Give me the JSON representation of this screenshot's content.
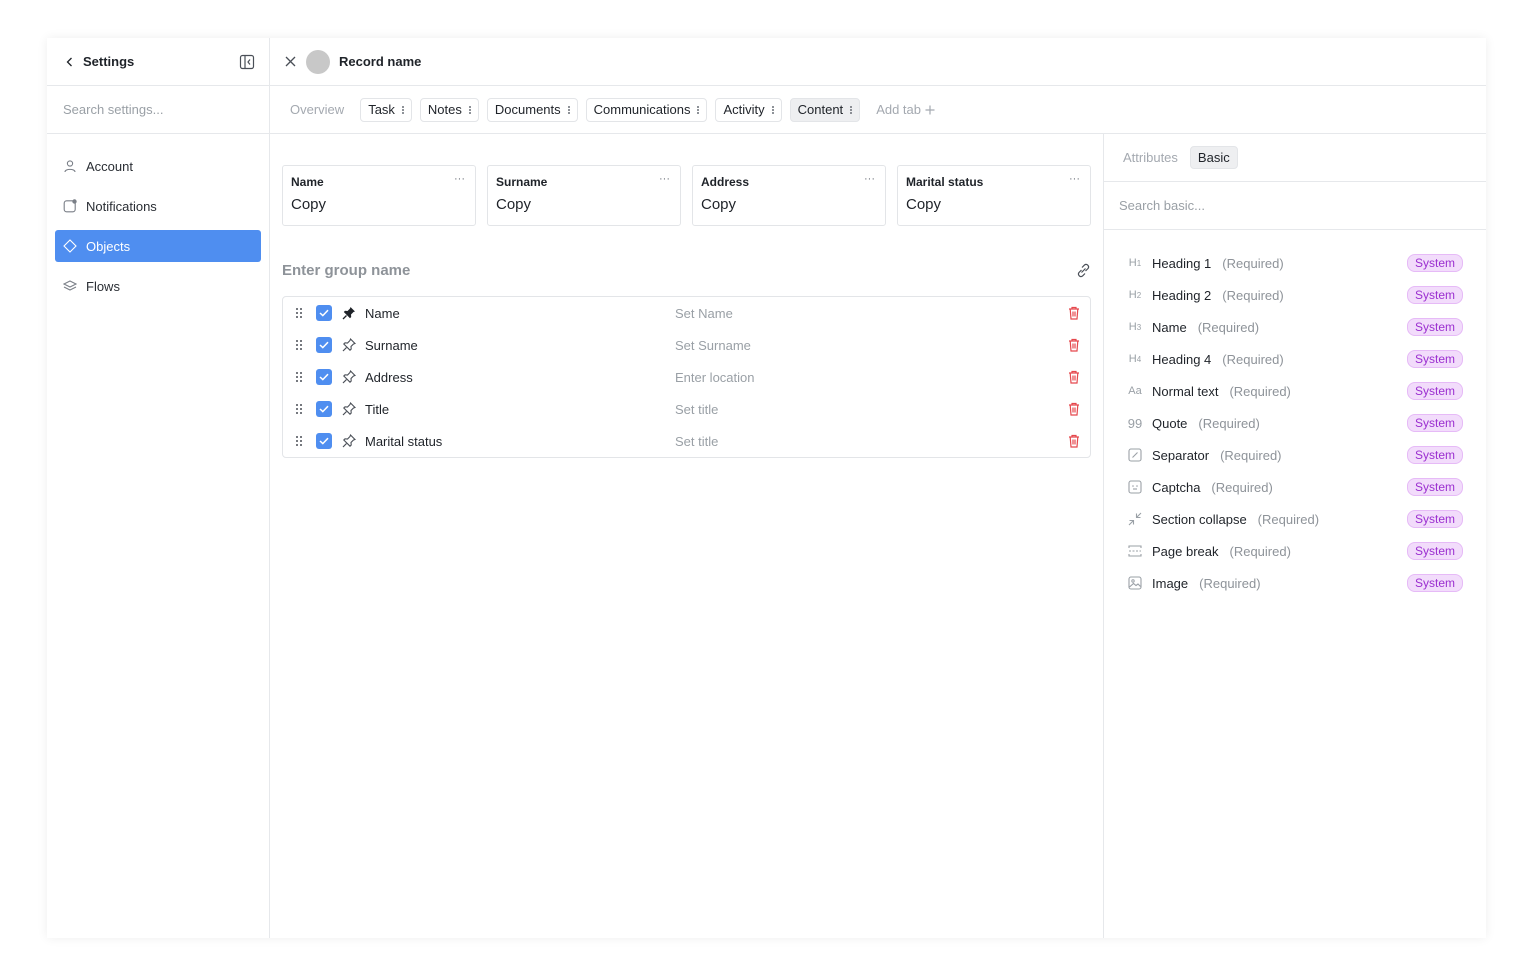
{
  "sidebar": {
    "title": "Settings",
    "search_placeholder": "Search settings...",
    "items": [
      {
        "label": "Account",
        "icon": "user-icon"
      },
      {
        "label": "Notifications",
        "icon": "notification-icon"
      },
      {
        "label": "Objects",
        "icon": "diamond-icon",
        "active": true
      },
      {
        "label": "Flows",
        "icon": "layers-icon"
      }
    ]
  },
  "header": {
    "record_name": "Record name"
  },
  "tabs": {
    "overview": "Overview",
    "chips": [
      "Task",
      "Notes",
      "Documents",
      "Communications",
      "Activity",
      "Content"
    ],
    "active": "Content",
    "add_tab": "Add tab"
  },
  "cards": [
    {
      "label": "Name",
      "value": "Copy"
    },
    {
      "label": "Surname",
      "value": "Copy"
    },
    {
      "label": "Address",
      "value": "Copy"
    },
    {
      "label": "Marital status",
      "value": "Copy"
    }
  ],
  "group": {
    "placeholder": "Enter group name"
  },
  "fields": [
    {
      "name": "Name",
      "placeholder": "Set Name",
      "checked": true,
      "pinned": true
    },
    {
      "name": "Surname",
      "placeholder": "Set Surname",
      "checked": true,
      "pinned": false
    },
    {
      "name": "Address",
      "placeholder": "Enter location",
      "checked": true,
      "pinned": false
    },
    {
      "name": "Title",
      "placeholder": "Set title",
      "checked": true,
      "pinned": false
    },
    {
      "name": "Marital status",
      "placeholder": "Set title",
      "checked": true,
      "pinned": false
    }
  ],
  "right_panel": {
    "tab_attributes": "Attributes",
    "tab_basic": "Basic",
    "search_placeholder": "Search basic...",
    "items": [
      {
        "icon": "heading-1-icon",
        "glyph": "H1",
        "name": "Heading 1",
        "req": "(Required)",
        "badge": "System"
      },
      {
        "icon": "heading-2-icon",
        "glyph": "H2",
        "name": "Heading 2",
        "req": "(Required)",
        "badge": "System"
      },
      {
        "icon": "heading-3-icon",
        "glyph": "H3",
        "name": "Name",
        "req": "(Required)",
        "badge": "System"
      },
      {
        "icon": "heading-4-icon",
        "glyph": "H4",
        "name": "Heading 4",
        "req": "(Required)",
        "badge": "System"
      },
      {
        "icon": "text-icon",
        "glyph": "Aa",
        "name": "Normal text",
        "req": "(Required)",
        "badge": "System"
      },
      {
        "icon": "quote-icon",
        "glyph": "99",
        "name": "Quote",
        "req": "(Required)",
        "badge": "System"
      },
      {
        "icon": "separator-icon",
        "glyph": "",
        "name": "Separator",
        "req": "(Required)",
        "badge": "System"
      },
      {
        "icon": "captcha-icon",
        "glyph": "",
        "name": "Captcha",
        "req": "(Required)",
        "badge": "System"
      },
      {
        "icon": "collapse-icon",
        "glyph": "",
        "name": "Section collapse",
        "req": "(Required)",
        "badge": "System"
      },
      {
        "icon": "page-break-icon",
        "glyph": "",
        "name": "Page break",
        "req": "(Required)",
        "badge": "System"
      },
      {
        "icon": "image-icon",
        "glyph": "",
        "name": "Image",
        "req": "(Required)",
        "badge": "System"
      }
    ]
  },
  "colors": {
    "accent": "#4f8ef0",
    "danger": "#e5484d",
    "badge_bg": "#f2dcfb",
    "badge_text": "#9b2fd0"
  }
}
